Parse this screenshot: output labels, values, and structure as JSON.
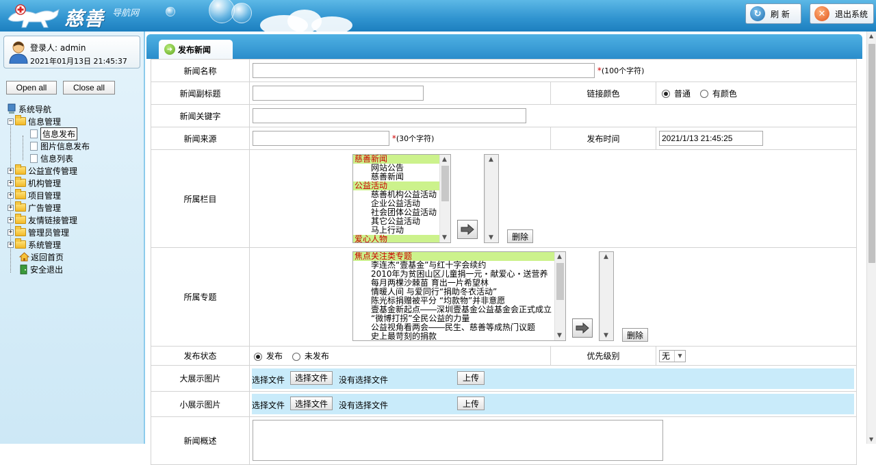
{
  "header": {
    "logo_text": "慈善",
    "logo_sub": "导航网",
    "refresh_label": "刷 新",
    "logout_label": "退出系统"
  },
  "sidebar": {
    "login_user": "登录人: admin",
    "login_time": "2021年01月13日 21:45:37",
    "open_all": "Open all",
    "close_all": "Close all",
    "root": "系统导航",
    "items": [
      {
        "label": "信息管理"
      },
      {
        "label": "信息发布"
      },
      {
        "label": "图片信息发布"
      },
      {
        "label": "信息列表"
      },
      {
        "label": "公益宣传管理"
      },
      {
        "label": "机构管理"
      },
      {
        "label": "项目管理"
      },
      {
        "label": "广告管理"
      },
      {
        "label": "友情链接管理"
      },
      {
        "label": "管理员管理"
      },
      {
        "label": "系统管理"
      },
      {
        "label": "返回首页"
      },
      {
        "label": "安全退出"
      }
    ]
  },
  "main": {
    "tab_label": "发布新闻",
    "fields": {
      "title_label": "新闻名称",
      "title_hint": "(100个字符)",
      "subtitle_label": "新闻副标题",
      "link_color_label": "链接颜色",
      "color_normal": "普通",
      "color_colored": "有颜色",
      "keyword_label": "新闻关键字",
      "source_label": "新闻来源",
      "source_hint": "(30个字符)",
      "publish_time_label": "发布时间",
      "publish_time_value": "2021/1/13 21:45:25",
      "category_label": "所属栏目",
      "topic_label": "所属专题",
      "delete_label": "删除",
      "status_label": "发布状态",
      "status_published": "发布",
      "status_unpublished": "未发布",
      "priority_label": "优先级别",
      "priority_value": "无",
      "big_image_label": "大展示图片",
      "small_image_label": "小展示图片",
      "choose_file_text": "选择文件",
      "choose_file_button": "选择文件",
      "no_file": "没有选择文件",
      "upload_button": "上传",
      "summary_label": "新闻概述",
      "required_mark": "*"
    },
    "categories": [
      {
        "text": "慈善新闻",
        "highlight": true
      },
      {
        "text": "网站公告",
        "highlight": false
      },
      {
        "text": "慈善新闻",
        "highlight": false
      },
      {
        "text": "公益活动",
        "highlight": true
      },
      {
        "text": "慈善机构公益活动",
        "highlight": false
      },
      {
        "text": "企业公益活动",
        "highlight": false
      },
      {
        "text": "社会团体公益活动",
        "highlight": false
      },
      {
        "text": "其它公益活动",
        "highlight": false
      },
      {
        "text": "马上行动",
        "highlight": false
      },
      {
        "text": "爱心人物",
        "highlight": true
      }
    ],
    "topics": [
      {
        "text": "焦点关注类专题",
        "highlight": true
      },
      {
        "text": "李连杰“壹基金”与红十字会续约",
        "highlight": false
      },
      {
        "text": "2010年为贫困山区儿童捐一元・献爱心・送营养",
        "highlight": false
      },
      {
        "text": "每月两棵沙棘苗  育出一片希望林",
        "highlight": false
      },
      {
        "text": "情暖人间 与爱同行“捐助冬衣活动”",
        "highlight": false
      },
      {
        "text": "陈光标捐赠被平分 “均款物”并非意愿",
        "highlight": false
      },
      {
        "text": "壹基金新起点――深圳壹基金公益基金会正式成立",
        "highlight": false
      },
      {
        "text": "“微博打拐”全民公益的力量",
        "highlight": false
      },
      {
        "text": "公益视角看两会――民生、慈善等成热门议题",
        "highlight": false
      },
      {
        "text": "史上最苛刻的捐款",
        "highlight": false
      }
    ]
  }
}
